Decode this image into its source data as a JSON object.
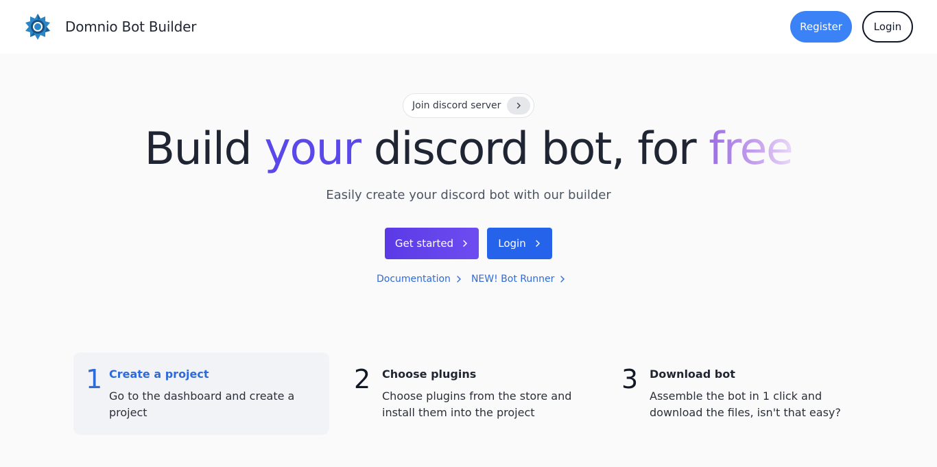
{
  "navbar": {
    "brand_name": "Domnio Bot Builder",
    "logo_icon": "gear-logo-icon",
    "register_label": "Register",
    "login_label": "Login"
  },
  "hero": {
    "pill_text": "Join discord server",
    "headline": {
      "part1": "Build ",
      "highlight1": "your",
      "part2": " discord bot, for ",
      "highlight2": "free"
    },
    "subtitle": "Easily create your discord bot with our builder",
    "get_started_label": "Get started",
    "login_label": "Login",
    "links": [
      {
        "label": "Documentation"
      },
      {
        "label": "NEW! Bot Runner"
      }
    ]
  },
  "steps": [
    {
      "number": "1",
      "title": "Create a project",
      "description": "Go to the dashboard and create a project",
      "active": true
    },
    {
      "number": "2",
      "title": "Choose plugins",
      "description": "Choose plugins from the store and install them into the project",
      "active": false
    },
    {
      "number": "3",
      "title": "Download bot",
      "description": "Assemble the bot in 1 click and download the files, isn't that easy?",
      "active": false
    }
  ],
  "colors": {
    "accent_blue": "#3b82f6",
    "primary_blue": "#2563eb",
    "purple": "#5b48ea",
    "link_blue": "#2f6ad9"
  }
}
